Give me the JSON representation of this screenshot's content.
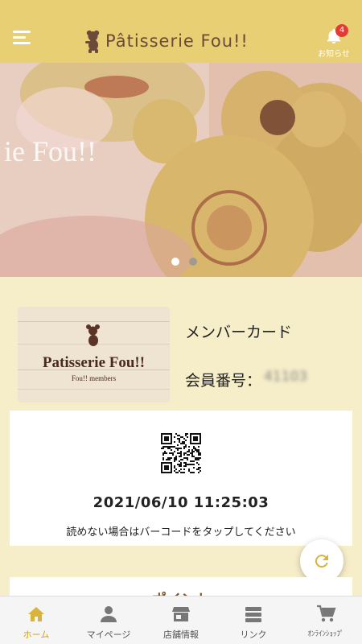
{
  "header": {
    "brand": "Pâtisserie Fou!!",
    "notifications": {
      "label": "お知らせ",
      "count": "4"
    }
  },
  "colors": {
    "header": "#e8cf74",
    "accent": "#c9a227",
    "background": "#f6edc9",
    "badge": "#e53935"
  },
  "hero": {
    "slides": 2,
    "active_slide": 1,
    "bag_text": "ie Fou!!"
  },
  "member_card": {
    "image_brand": "Patisserie Fou!!",
    "image_subtitle": "Fou!! members",
    "title": "メンバーカード",
    "number_label": "会員番号：",
    "number_value": "41103"
  },
  "qr_panel": {
    "datetime": "2021/06/10 11:25:03",
    "hint": "読めない場合はバーコードをタップしてください"
  },
  "points": {
    "title": "ポイント"
  },
  "tabs": [
    {
      "label": "ホーム",
      "icon": "home-icon",
      "active": true
    },
    {
      "label": "マイページ",
      "icon": "person-icon",
      "active": false
    },
    {
      "label": "店舗情報",
      "icon": "store-icon",
      "active": false
    },
    {
      "label": "リンク",
      "icon": "list-icon",
      "active": false
    },
    {
      "label": "ｵﾝﾗｲﾝｼｮｯﾌﾟ",
      "icon": "cart-icon",
      "active": false
    }
  ]
}
